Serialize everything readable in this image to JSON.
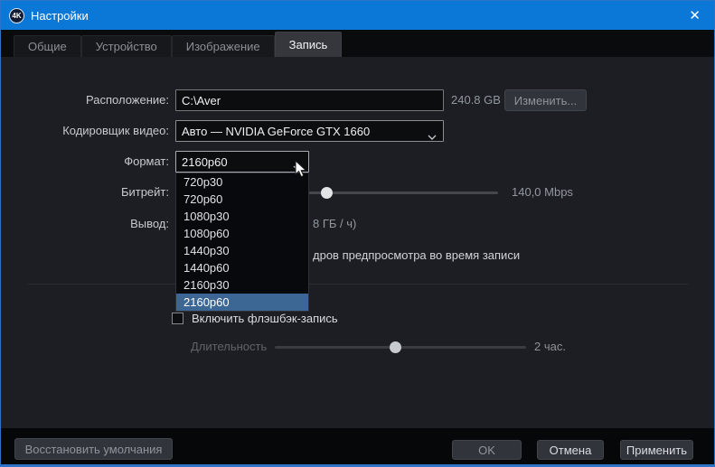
{
  "window": {
    "logo": "4K",
    "title": "Настройки",
    "close_glyph": "✕"
  },
  "tabs": [
    {
      "label": "Общие"
    },
    {
      "label": "Устройство"
    },
    {
      "label": "Изображение"
    },
    {
      "label": "Запись",
      "active": true
    }
  ],
  "form": {
    "location": {
      "label": "Расположение:",
      "value": "C:\\Aver",
      "free_space": "240.8 GB",
      "change_button": "Изменить..."
    },
    "encoder": {
      "label": "Кодировщик видео:",
      "value": "Авто — NVIDIA GeForce GTX 1660"
    },
    "format": {
      "label": "Формат:",
      "value": "2160p60",
      "selected": "2160p60",
      "options": [
        "720p30",
        "720p60",
        "1080p30",
        "1080p60",
        "1440p30",
        "1440p60",
        "2160p30",
        "2160p60"
      ]
    },
    "bitrate": {
      "label": "Битрейт:",
      "value": "140,0 Mbps"
    },
    "output": {
      "label": "Вывод:",
      "visible_value": "8 ГБ / ч)"
    },
    "preview": {
      "visible_label": "дров предпросмотра во время записи"
    },
    "flashback": {
      "label": "Включить флэшбэк-запись",
      "checked": false
    },
    "duration": {
      "label": "Длительность",
      "value": "2 час."
    }
  },
  "footer": {
    "restore_defaults": "Восстановить умолчания",
    "ok": "OK",
    "cancel": "Отмена",
    "apply": "Применить"
  },
  "colors": {
    "titlebar": "#0b77d7",
    "window_border": "#2e74c6",
    "content_bg": "#1d1e23",
    "selection": "#3c6795",
    "active_tab_bg": "#35373d"
  }
}
